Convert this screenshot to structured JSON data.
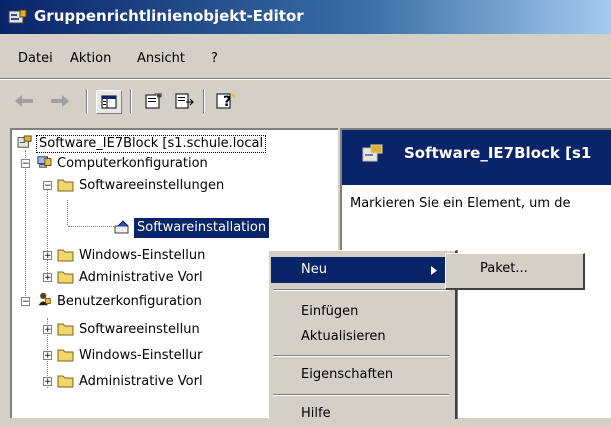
{
  "window": {
    "title": "Gruppenrichtlinienobjekt-Editor"
  },
  "menu": [
    "Datei",
    "Aktion",
    "Ansicht",
    "?"
  ],
  "toolbar": {
    "icons": [
      "back-arrow-icon",
      "forward-arrow-icon",
      "show-hide-tree-icon",
      "properties-icon",
      "export-list-icon",
      "help-icon"
    ]
  },
  "tree": {
    "root": "Software_IE7Block [s1.schule.local",
    "computer": "Computerkonfiguration",
    "comp_software": "Softwareeinstellungen",
    "comp_softinstall": "Softwareinstallation",
    "comp_windows": "Windows-Einstellun",
    "comp_admin": "Administrative Vorl",
    "user": "Benutzerkonfiguration",
    "user_software": "Softwareeinstellun",
    "user_windows": "Windows-Einstellur",
    "user_admin": "Administrative Vorl"
  },
  "right": {
    "header": "Software_IE7Block [s1",
    "description": "Markieren Sie ein Element, um de"
  },
  "context_menu": {
    "items": [
      "Neu",
      "Einfügen",
      "Aktualisieren",
      "Eigenschaften",
      "Hilfe"
    ],
    "submenu_item": "Paket..."
  },
  "colors": {
    "selection": "#0a246a",
    "face": "#d4d0c8",
    "folder": "#f0d868"
  }
}
